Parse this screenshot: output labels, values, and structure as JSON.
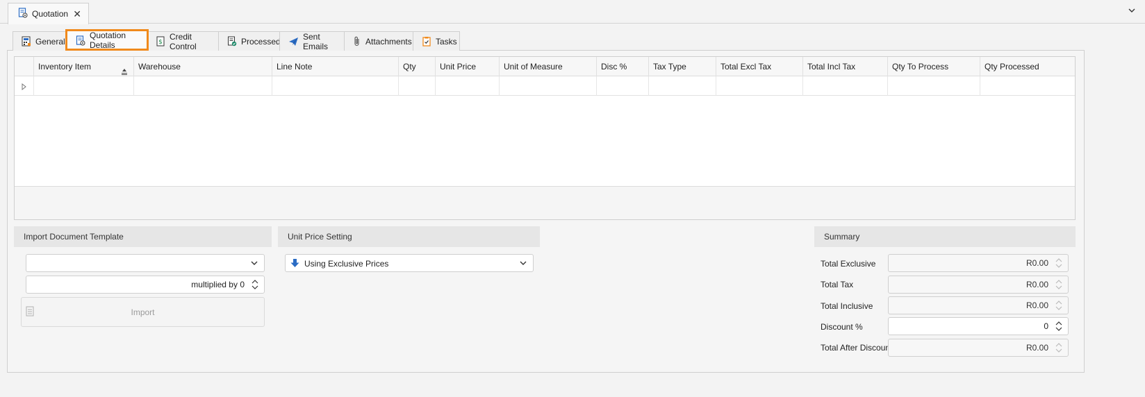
{
  "window": {
    "doc_tab_label": "Quotation",
    "close_glyph": "✕"
  },
  "tabs": [
    {
      "label": "General",
      "icon": "calculator-icon"
    },
    {
      "label": "Quotation Details",
      "icon": "document-gear-icon",
      "active": true
    },
    {
      "label": "Credit Control",
      "icon": "dollar-document-icon"
    },
    {
      "label": "Processed",
      "icon": "document-check-icon"
    },
    {
      "label": "Sent Emails",
      "icon": "paper-plane-icon"
    },
    {
      "label": "Attachments",
      "icon": "paperclip-icon"
    },
    {
      "label": "Tasks",
      "icon": "clipboard-check-icon"
    }
  ],
  "grid": {
    "columns": [
      "Inventory Item",
      "Warehouse",
      "Line Note",
      "Qty",
      "Unit Price",
      "Unit of Measure",
      "Disc %",
      "Tax Type",
      "Total Excl Tax",
      "Total Incl Tax",
      "Qty To Process",
      "Qty Processed"
    ]
  },
  "import_template": {
    "header": "Import Document Template",
    "template_value": "",
    "multiplier_value": "multiplied by 0",
    "import_label": "Import"
  },
  "unit_price_setting": {
    "header": "Unit Price Setting",
    "selected": "Using Exclusive Prices"
  },
  "summary": {
    "header": "Summary",
    "rows": [
      {
        "label": "Total Exclusive",
        "value": "R0.00",
        "readonly": true
      },
      {
        "label": "Total Tax",
        "value": "R0.00",
        "readonly": true
      },
      {
        "label": "Total Inclusive",
        "value": "R0.00",
        "readonly": true
      },
      {
        "label": "Discount %",
        "value": "0",
        "readonly": false
      },
      {
        "label": "Total After Discount",
        "value": "R0.00",
        "readonly": true
      }
    ]
  },
  "colors": {
    "active_tab_outline": "#f08a1c",
    "accent_blue": "#2b6cc4"
  }
}
